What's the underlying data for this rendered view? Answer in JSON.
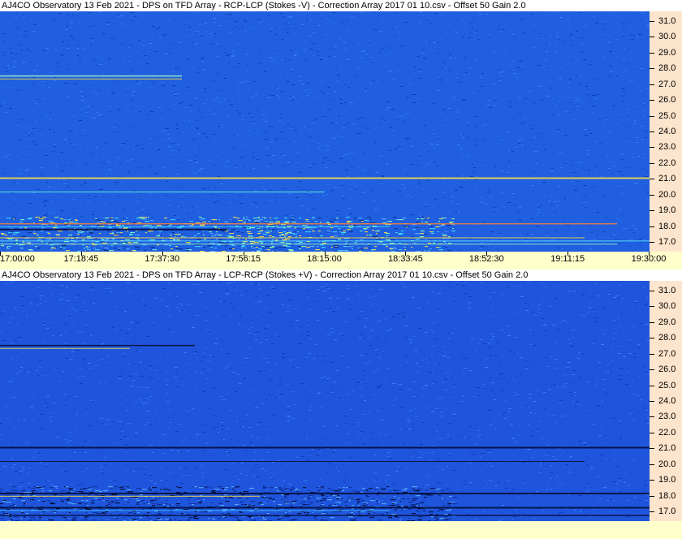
{
  "chart_data": [
    {
      "type": "heatmap",
      "title": "AJ4CO Observatory 13 Feb 2021  -  DPS on TFD Array  -  RCP-LCP (Stokes -V)  -  Correction Array 2017 01 10.csv  -  Offset 50  Gain 2.0",
      "x_tick_labels": [
        "17:00:00",
        "17:18:45",
        "17:37:30",
        "17:56:15",
        "18:15:00",
        "18:33:45",
        "18:52:30",
        "19:11:15",
        "19:30:00"
      ],
      "y_tick_labels": [
        "31.0",
        "30.0",
        "29.0",
        "28.0",
        "27.0",
        "26.0",
        "25.0",
        "24.0",
        "23.0",
        "22.0",
        "21.0",
        "20.0",
        "19.0",
        "18.0",
        "17.0"
      ],
      "xlim": [
        "17:00:00",
        "19:30:00"
      ],
      "ylim": [
        16.4,
        31.6
      ],
      "xlabel": "",
      "ylabel": "",
      "colors": {
        "background": "#1f5fe0",
        "band_hot": "#ffe040",
        "band_dark": "#000a40"
      }
    },
    {
      "type": "heatmap",
      "title": "AJ4CO Observatory 13 Feb 2021  -  DPS on TFD Array  -  LCP-RCP (Stokes +V)  -  Correction Array 2017 01 10.csv  -  Offset 50  Gain 2.0",
      "x_tick_labels": [],
      "y_tick_labels": [
        "31.0",
        "30.0",
        "29.0",
        "28.0",
        "27.0",
        "26.0",
        "25.0",
        "24.0",
        "23.0",
        "22.0",
        "21.0",
        "20.0",
        "19.0",
        "18.0",
        "17.0"
      ],
      "xlim": [
        "17:00:00",
        "19:30:00"
      ],
      "ylim": [
        16.4,
        31.6
      ],
      "xlabel": "",
      "ylabel": "",
      "colors": {
        "background": "#1f55dc",
        "band_hot": "#ffe040",
        "band_dark": "#000a30"
      }
    }
  ]
}
